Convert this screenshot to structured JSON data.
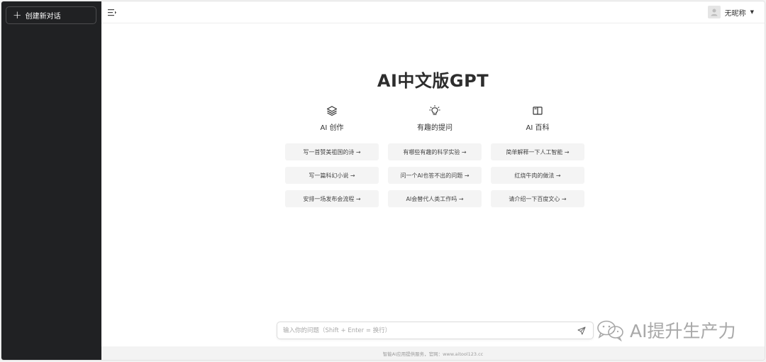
{
  "sidebar": {
    "new_chat_label": "创建新对话"
  },
  "header": {
    "username": "无昵称",
    "menu_icon": "menu-icon",
    "avatar_icon": "user-icon"
  },
  "main": {
    "title": "AI中文版GPT",
    "columns": [
      {
        "icon": "layers-icon",
        "label": "AI 创作",
        "prompts": [
          "写一首赞美祖国的诗 →",
          "写一篇科幻小说 →",
          "安排一场发布会流程 →"
        ]
      },
      {
        "icon": "lightbulb-icon",
        "label": "有趣的提问",
        "prompts": [
          "有哪些有趣的科学实验 →",
          "问一个AI也答不出的问题 →",
          "AI会替代人类工作吗 →"
        ]
      },
      {
        "icon": "book-icon",
        "label": "AI 百科",
        "prompts": [
          "简单解释一下人工智能 →",
          "红烧牛肉的做法 →",
          "请介绍一下百度文心 →"
        ]
      }
    ]
  },
  "input": {
    "placeholder": "输入你的问题（Shift + Enter = 换行）",
    "value": ""
  },
  "footer": {
    "text": "智能AI应用提供服务，官网：www.aitool123.cc"
  },
  "watermark": {
    "text": "AI提升生产力"
  }
}
